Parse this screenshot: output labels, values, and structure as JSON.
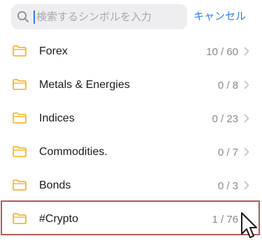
{
  "search": {
    "placeholder": "検索するシンボルを入力",
    "value": "",
    "cancel_label": "キャンセル",
    "accent_color": "#2f7fec"
  },
  "folders": [
    {
      "label": "Forex",
      "count": "10 / 60",
      "icon": "folder-icon"
    },
    {
      "label": "Metals & Energies",
      "count": "0 / 8",
      "icon": "folder-icon"
    },
    {
      "label": "Indices",
      "count": "0 / 23",
      "icon": "folder-icon"
    },
    {
      "label": "Commodities.",
      "count": "0 / 7",
      "icon": "folder-icon"
    },
    {
      "label": "Bonds",
      "count": "0 / 3",
      "icon": "folder-icon"
    },
    {
      "label": "#Crypto",
      "count": "1 / 76",
      "icon": "folder-icon",
      "highlighted": true
    }
  ],
  "colors": {
    "folder": "#f6b731",
    "highlight": "#b55a5a",
    "chevron": "#c4c4c8"
  }
}
